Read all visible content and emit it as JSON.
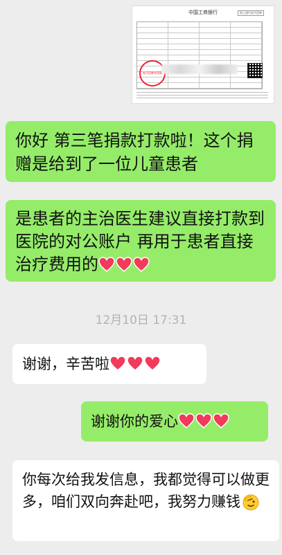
{
  "receipt": {
    "bank_title": "中国工商银行",
    "badge": "网上银行电子回单",
    "stamp_text": "电子回单专用章"
  },
  "messages": [
    {
      "side": "right",
      "text": "你好 第三笔捐款打款啦！这个捐赠是给到了一位儿童患者"
    },
    {
      "side": "right",
      "text": "是患者的主治医生建议直接打款到医院的对公账户 再用于患者直接治疗费用的"
    },
    {
      "side": "left",
      "text": "谢谢，辛苦啦"
    },
    {
      "side": "right",
      "text": "谢谢你的爱心"
    },
    {
      "side": "left",
      "text": "你每次给我发信息，我都觉得可以做更多，咱们双向奔赴吧，我努力赚钱"
    }
  ],
  "timestamp": "12月10日 17:31",
  "colors": {
    "background": "#ededed",
    "bubble_green": "#95ec69",
    "bubble_white": "#ffffff",
    "heart_red": "#f23a5a",
    "timestamp_gray": "#b3b3b3"
  },
  "icons": [
    "heart-emoji-icon",
    "saluting-face-emoji-icon"
  ]
}
